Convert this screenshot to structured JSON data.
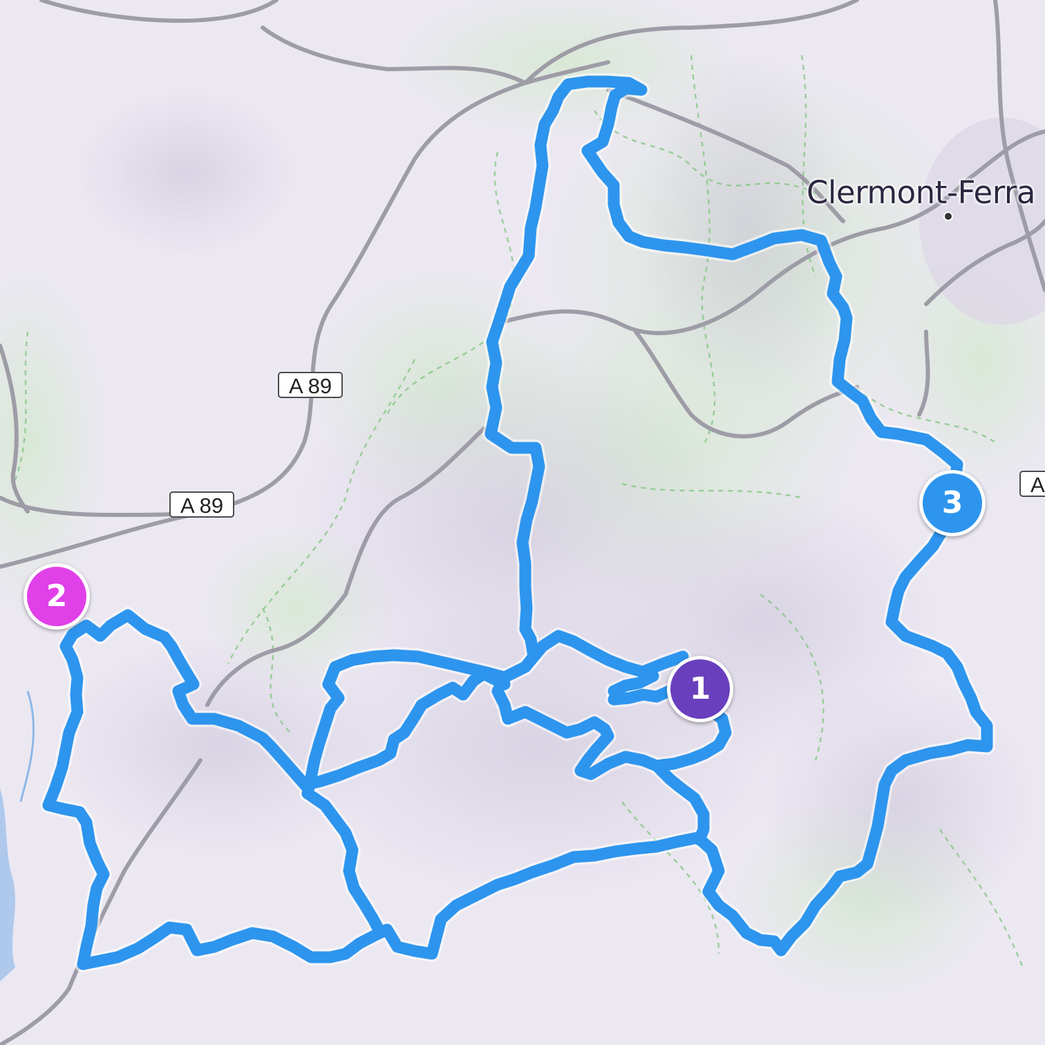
{
  "map": {
    "city": {
      "name": "Clermont-Ferra"
    },
    "road_shields": [
      {
        "id": "a89-north",
        "label": "A 89"
      },
      {
        "id": "a89-south",
        "label": "A 89"
      },
      {
        "id": "a-east",
        "label": "A"
      }
    ],
    "waypoints": [
      {
        "id": "1",
        "label": "1",
        "color": "#6a3fbd"
      },
      {
        "id": "2",
        "label": "2",
        "color": "#e040e8"
      },
      {
        "id": "3",
        "label": "3",
        "color": "#2d95ee"
      }
    ],
    "colors": {
      "route": "#2d95ee",
      "road": "#9e9ca6",
      "terrain_base": "#ece8f2",
      "forest": "#dfe9dc",
      "urban": "#d9d4e3",
      "water": "#8fb7e6"
    },
    "icons": [
      "city-dot-icon",
      "route-line",
      "waypoint-marker"
    ]
  }
}
